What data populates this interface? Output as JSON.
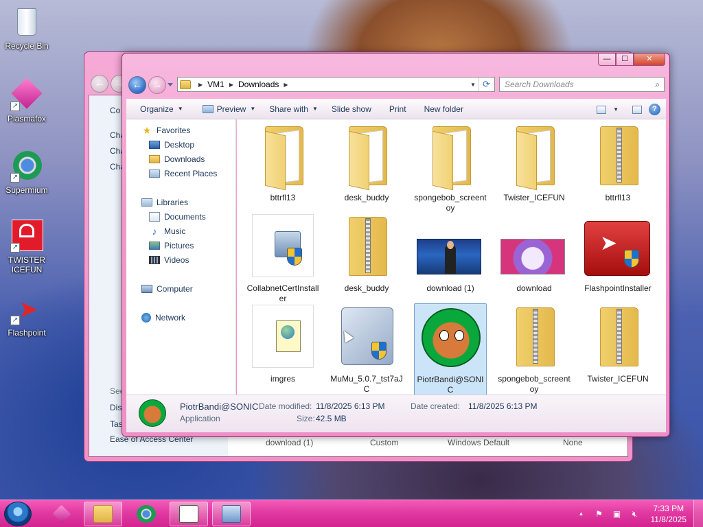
{
  "desktop": {
    "icons": [
      {
        "label": "Recycle Bin"
      },
      {
        "label": "Plasmafox"
      },
      {
        "label": "Supermium"
      },
      {
        "label": "TWISTER ICEFUN"
      },
      {
        "label": "Flashpoint"
      }
    ]
  },
  "back_window": {
    "sidebar_lines": [
      "Co",
      "Cha",
      "Cha",
      "Cha"
    ],
    "see_also": "See",
    "links": [
      "Disp",
      "Tas",
      "Ease of Access Center"
    ],
    "row": [
      "download (1)",
      "Custom",
      "Windows Default",
      "None"
    ]
  },
  "explorer": {
    "caption": {
      "minimize": "—",
      "maximize": "☐",
      "close": "✕"
    },
    "address": {
      "segments": [
        "VM1",
        "Downloads"
      ]
    },
    "search_placeholder": "Search Downloads",
    "toolbar": {
      "organize": "Organize",
      "preview": "Preview",
      "share_with": "Share with",
      "slide_show": "Slide show",
      "print": "Print",
      "new_folder": "New folder"
    },
    "nav": {
      "favorites": "Favorites",
      "desktop": "Desktop",
      "downloads": "Downloads",
      "recent": "Recent Places",
      "libraries": "Libraries",
      "documents": "Documents",
      "music": "Music",
      "pictures": "Pictures",
      "videos": "Videos",
      "computer": "Computer",
      "network": "Network"
    },
    "files": [
      {
        "name": "bttrfl13",
        "kind": "folder"
      },
      {
        "name": "desk_buddy",
        "kind": "folder"
      },
      {
        "name": "spongebob_screentoy",
        "kind": "folder"
      },
      {
        "name": "Twister_ICEFUN",
        "kind": "folder"
      },
      {
        "name": "bttrfl13",
        "kind": "zip"
      },
      {
        "name": "CollabnetCertInstaller",
        "kind": "installer"
      },
      {
        "name": "desk_buddy",
        "kind": "zip"
      },
      {
        "name": "download (1)",
        "kind": "image"
      },
      {
        "name": "download",
        "kind": "image"
      },
      {
        "name": "FlashpointInstaller",
        "kind": "installer"
      },
      {
        "name": "imgres",
        "kind": "webpage"
      },
      {
        "name": "MuMu_5.0.7_tst7aJC",
        "kind": "installer"
      },
      {
        "name": "PiotrBandi@SONIC",
        "kind": "application",
        "selected": true
      },
      {
        "name": "spongebob_screentoy",
        "kind": "zip"
      },
      {
        "name": "Twister_ICEFUN",
        "kind": "zip"
      }
    ],
    "details": {
      "name": "PiotrBandi@SONIC",
      "type": "Application",
      "date_modified_label": "Date modified:",
      "date_modified": "11/8/2025 6:13 PM",
      "size_label": "Size:",
      "size": "42.5 MB",
      "date_created_label": "Date created:",
      "date_created": "11/8/2025 6:13 PM"
    }
  },
  "taskbar": {
    "time": "7:33 PM",
    "date": "11/8/2025",
    "tray_chevron": "▲"
  },
  "colors": {
    "window_frame": "#ee8fc6",
    "taskbar": "#e13aa2",
    "selection": "#cce4f7"
  }
}
